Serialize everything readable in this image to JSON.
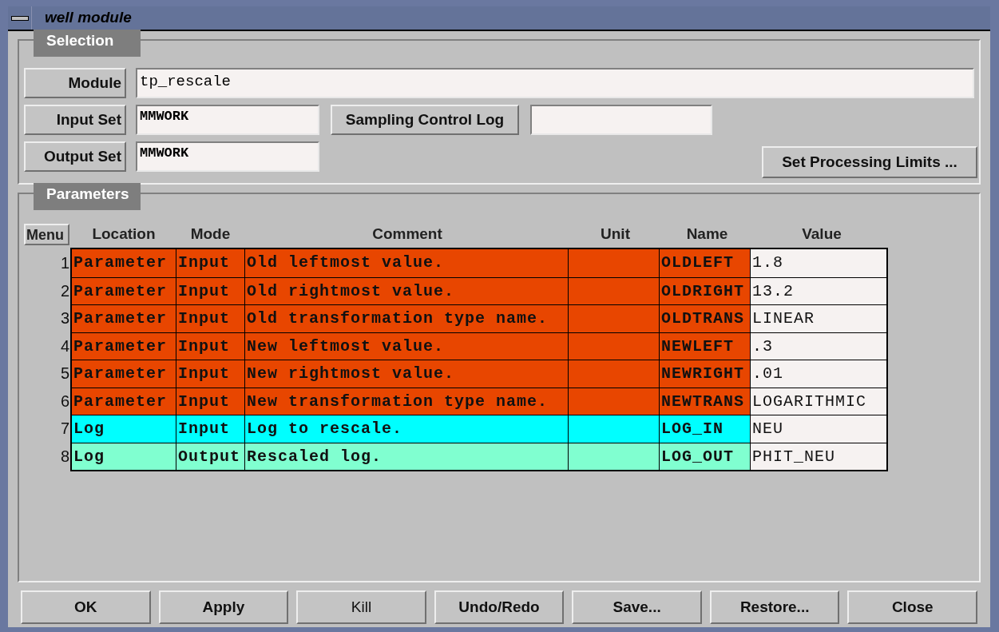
{
  "window": {
    "title": "well module"
  },
  "selection": {
    "label": "Selection",
    "module": {
      "button": "Module",
      "value": "tp_rescale"
    },
    "input_set": {
      "button": "Input Set",
      "value": "MMWORK"
    },
    "sampling_control_log": {
      "button": "Sampling Control Log"
    },
    "output_set": {
      "button": "Output Set",
      "value": "MMWORK"
    },
    "processing_limits_button": "Set Processing Limits ..."
  },
  "parameters": {
    "label": "Parameters",
    "menu_button": "Menu",
    "columns": [
      "Location",
      "Mode",
      "Comment",
      "Unit",
      "Name",
      "Value"
    ],
    "rows": [
      {
        "number": "1",
        "location": "Parameter",
        "mode": "Input",
        "comment": "Old leftmost value.",
        "name": "OLDLEFT",
        "value": "1.8",
        "color": "#e84600"
      },
      {
        "number": "2",
        "location": "Parameter",
        "mode": "Input",
        "comment": "Old rightmost value.",
        "name": "OLDRIGHT",
        "value": "13.2",
        "color": "#e84600"
      },
      {
        "number": "3",
        "location": "Parameter",
        "mode": "Input",
        "comment": "Old transformation type name.",
        "name": "OLDTRANS",
        "value": "LINEAR",
        "color": "#e84600"
      },
      {
        "number": "4",
        "location": "Parameter",
        "mode": "Input",
        "comment": "New leftmost value.",
        "name": "NEWLEFT",
        "value": ".3",
        "color": "#e84600"
      },
      {
        "number": "5",
        "location": "Parameter",
        "mode": "Input",
        "comment": "New rightmost value.",
        "name": "NEWRIGHT",
        "value": ".01",
        "color": "#e84600"
      },
      {
        "number": "6",
        "location": "Parameter",
        "mode": "Input",
        "comment": "New transformation type name.",
        "name": "NEWTRANS",
        "value": "LOGARITHMIC",
        "color": "#e84600"
      },
      {
        "number": "7",
        "location": "Log",
        "mode": "Input",
        "comment": "Log to rescale.",
        "name": "LOG_IN",
        "value": "NEU",
        "color": "#00ffff"
      },
      {
        "number": "8",
        "location": "Log",
        "mode": "Output",
        "comment": "Rescaled log.",
        "name": "LOG_OUT",
        "value": "PHIT_NEU",
        "color": "#80ffd0"
      }
    ]
  },
  "buttons": [
    {
      "label": "OK",
      "disabled": false
    },
    {
      "label": "Apply",
      "disabled": false
    },
    {
      "label": "Kill",
      "disabled": true
    },
    {
      "label": "Undo/Redo",
      "disabled": false
    },
    {
      "label": "Save...",
      "disabled": false
    },
    {
      "label": "Restore...",
      "disabled": false
    },
    {
      "label": "Close",
      "disabled": false
    }
  ]
}
